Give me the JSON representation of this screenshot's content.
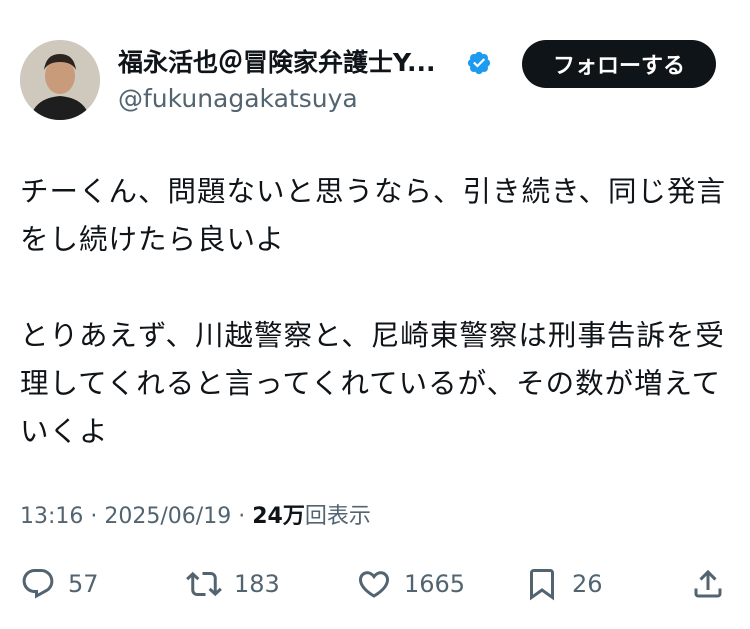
{
  "author": {
    "display_name": "福永活也＠冒険家弁護士Y...",
    "handle": "@fukunagakatsuya",
    "verified": true
  },
  "follow_button": {
    "label": "フォローする"
  },
  "tweet": {
    "paragraphs": [
      "チーくん、問題ないと思うなら、引き続き、同じ発言をし続けたら良いよ",
      "とりあえず、川越警察と、尼崎東警察は刑事告訴を受理してくれると言ってくれているが、その数が増えていくよ"
    ]
  },
  "meta": {
    "time": "13:16",
    "separator": "·",
    "date": "2025/06/19",
    "views_count": "24万",
    "views_label": "回表示"
  },
  "actions": {
    "replies": "57",
    "reposts": "183",
    "likes": "1665",
    "bookmarks": "26"
  },
  "colors": {
    "text": "#0f1419",
    "secondary": "#536471",
    "verified": "#1d9bf0",
    "button_bg": "#0f1419",
    "button_text": "#ffffff"
  },
  "icons": [
    "reply-icon",
    "repost-icon",
    "like-icon",
    "bookmark-icon",
    "share-icon",
    "verified-badge-icon"
  ]
}
